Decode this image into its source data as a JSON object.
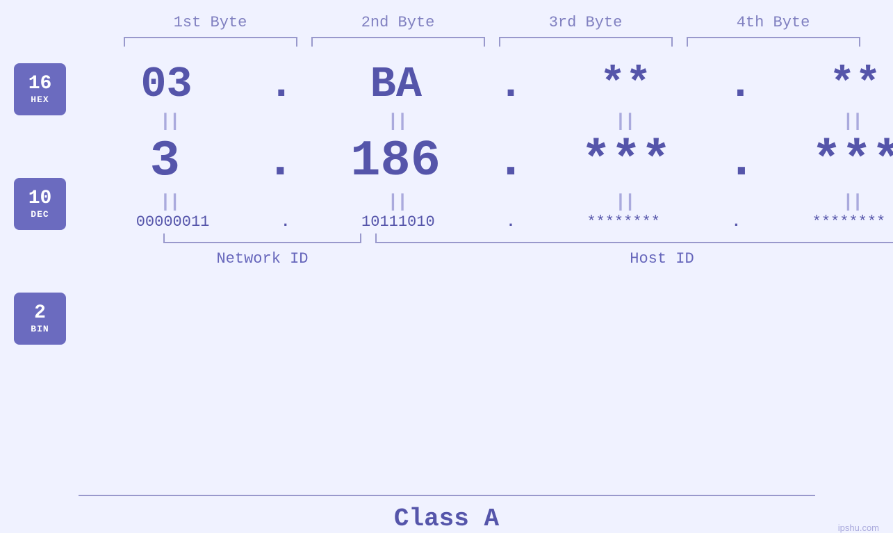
{
  "headers": {
    "byte1": "1st Byte",
    "byte2": "2nd Byte",
    "byte3": "3rd Byte",
    "byte4": "4th Byte"
  },
  "badges": [
    {
      "id": "hex-badge",
      "num": "16",
      "label": "HEX"
    },
    {
      "id": "dec-badge",
      "num": "10",
      "label": "DEC"
    },
    {
      "id": "bin-badge",
      "num": "2",
      "label": "BIN"
    }
  ],
  "hex_row": {
    "b1": "03",
    "b2": "BA",
    "b3": "**",
    "b4": "**"
  },
  "dec_row": {
    "b1": "3",
    "b2": "186.",
    "b3": "***.",
    "b4": "***"
  },
  "bin_row": {
    "b1": "00000011",
    "b2": "10111010",
    "b3": "********",
    "b4": "********"
  },
  "labels": {
    "network_id": "Network ID",
    "host_id": "Host ID",
    "class": "Class A"
  },
  "watermark": "ipshu.com"
}
